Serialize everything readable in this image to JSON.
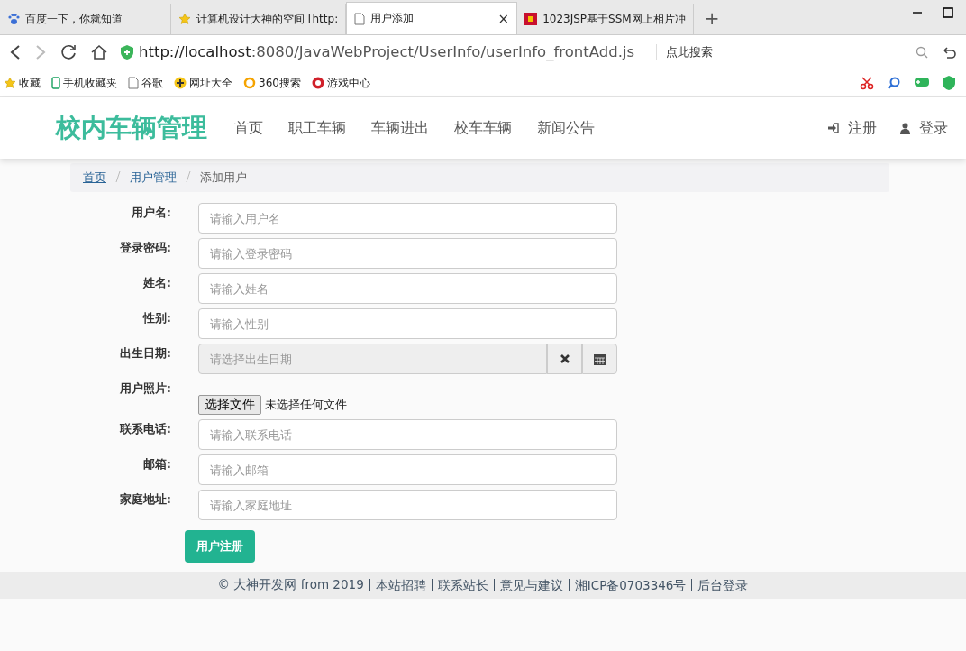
{
  "browser": {
    "tabs": [
      {
        "title": "百度一下，你就知道",
        "selected": false
      },
      {
        "title": "计算机设计大神的空间 [http:",
        "selected": false
      },
      {
        "title": "用户添加",
        "selected": true,
        "close": "×"
      },
      {
        "title": "1023JSP基于SSM网上相片冲",
        "selected": false
      }
    ],
    "new_tab": "+",
    "url_host": "http://localhost",
    "url_rest": ":8080/JavaWebProject/UserInfo/userInfo_frontAdd.js",
    "search_placeholder": "点此搜索",
    "bookmarks": [
      "收藏",
      "手机收藏夹",
      "谷歌",
      "网址大全",
      "360搜索",
      "游戏中心"
    ]
  },
  "navbar": {
    "brand": "校内车辆管理",
    "links": [
      "首页",
      "职工车辆",
      "车辆进出",
      "校车车辆",
      "新闻公告"
    ],
    "right": [
      "注册",
      "登录"
    ]
  },
  "breadcrumb": [
    {
      "label": "首页",
      "link": true
    },
    {
      "label": "用户管理",
      "link": true
    },
    {
      "label": "添加用户",
      "link": false
    }
  ],
  "form": {
    "fields": [
      {
        "label": "用户名:",
        "kind": "text",
        "placeholder": "请输入用户名"
      },
      {
        "label": "登录密码:",
        "kind": "text",
        "placeholder": "请输入登录密码"
      },
      {
        "label": "姓名:",
        "kind": "text",
        "placeholder": "请输入姓名"
      },
      {
        "label": "性别:",
        "kind": "text",
        "placeholder": "请输入性别"
      },
      {
        "label": "出生日期:",
        "kind": "date",
        "placeholder": "请选择出生日期"
      },
      {
        "label": "用户照片:",
        "kind": "file",
        "button": "选择文件",
        "status": "未选择任何文件"
      },
      {
        "label": "联系电话:",
        "kind": "text",
        "placeholder": "请输入联系电话"
      },
      {
        "label": "邮箱:",
        "kind": "text",
        "placeholder": "请输入邮箱"
      },
      {
        "label": "家庭地址:",
        "kind": "text",
        "placeholder": "请输入家庭地址"
      }
    ],
    "submit": "用户注册"
  },
  "footer": {
    "copyright": "© 大神开发网 from 2019",
    "links": [
      "本站招聘",
      "联系站长",
      "意见与建议",
      "湘ICP备0703346号",
      "后台登录"
    ]
  }
}
